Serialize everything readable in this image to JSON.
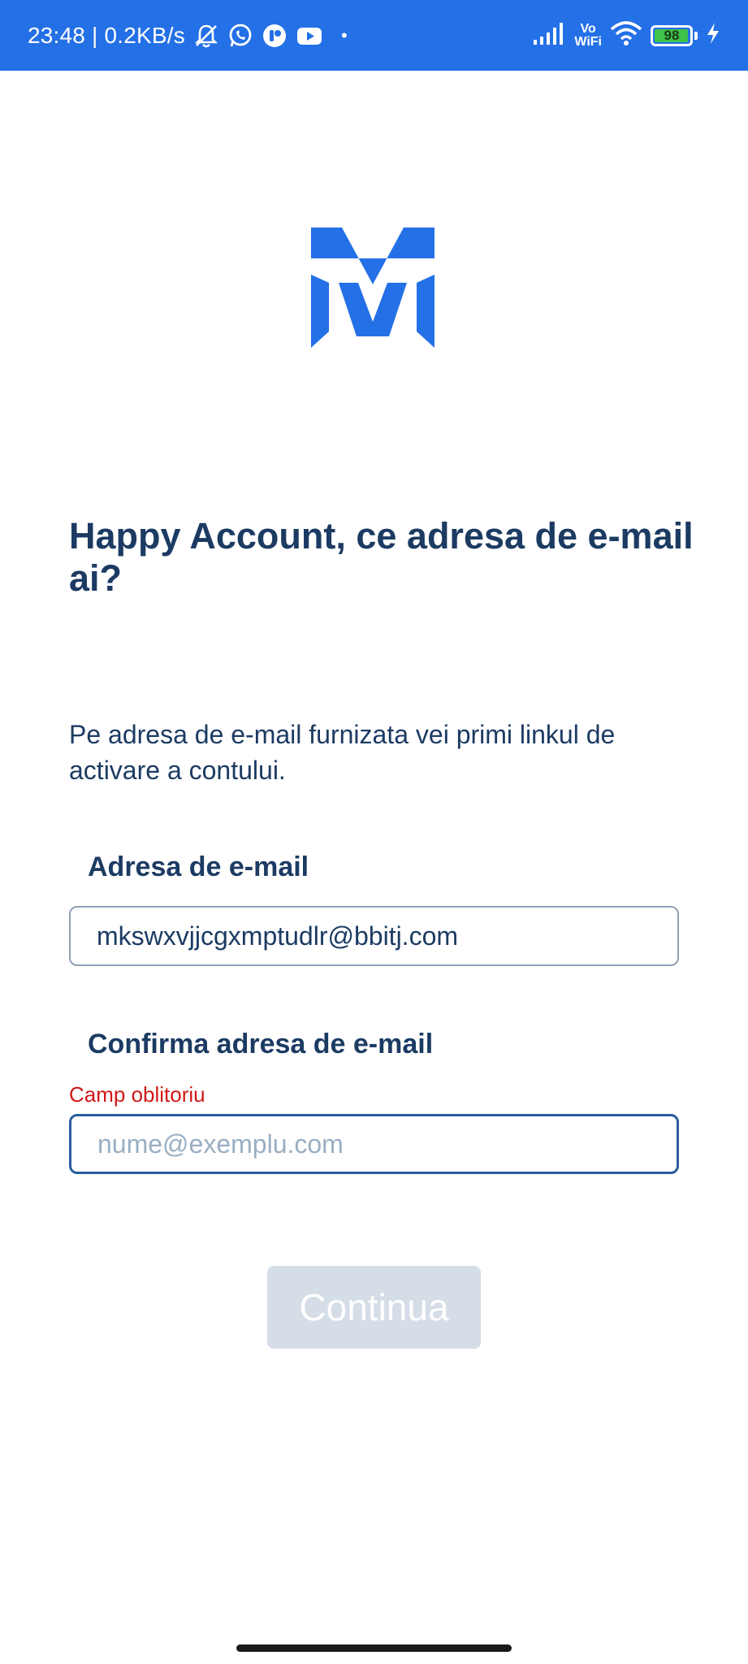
{
  "status_bar": {
    "time_speed": "23:48 | 0.2KB/s",
    "volte_top": "Vo",
    "volte_bottom": "WiFi",
    "battery_level": "98",
    "battery_fraction": 0.98,
    "icons": [
      "bell-off-icon",
      "whatsapp-icon",
      "app-icon",
      "youtube-icon",
      "dot-icon",
      "signal-icon",
      "volte-icon",
      "wifi-icon",
      "battery-icon",
      "charging-icon"
    ],
    "background_color": "#2470e6"
  },
  "logo": {
    "icon": "m-logo-icon",
    "color": "#2470e6"
  },
  "title": "Happy Account, ce adresa de e-mail ai?",
  "description": "Pe adresa de e-mail furnizata vei primi linkul de activare a contului.",
  "email_field": {
    "label": "Adresa de e-mail",
    "value": "mkswxvjjcgxmptudlr@bbitj.com"
  },
  "confirm_field": {
    "label": "Confirma adresa de e-mail",
    "error": "Camp oblitoriu",
    "value": "",
    "placeholder": "nume@exemplu.com"
  },
  "continue_button": {
    "label": "Continua",
    "enabled": false
  },
  "colors": {
    "text_primary": "#1c3b63",
    "error": "#d01818",
    "button_disabled": "#d5dde7"
  }
}
